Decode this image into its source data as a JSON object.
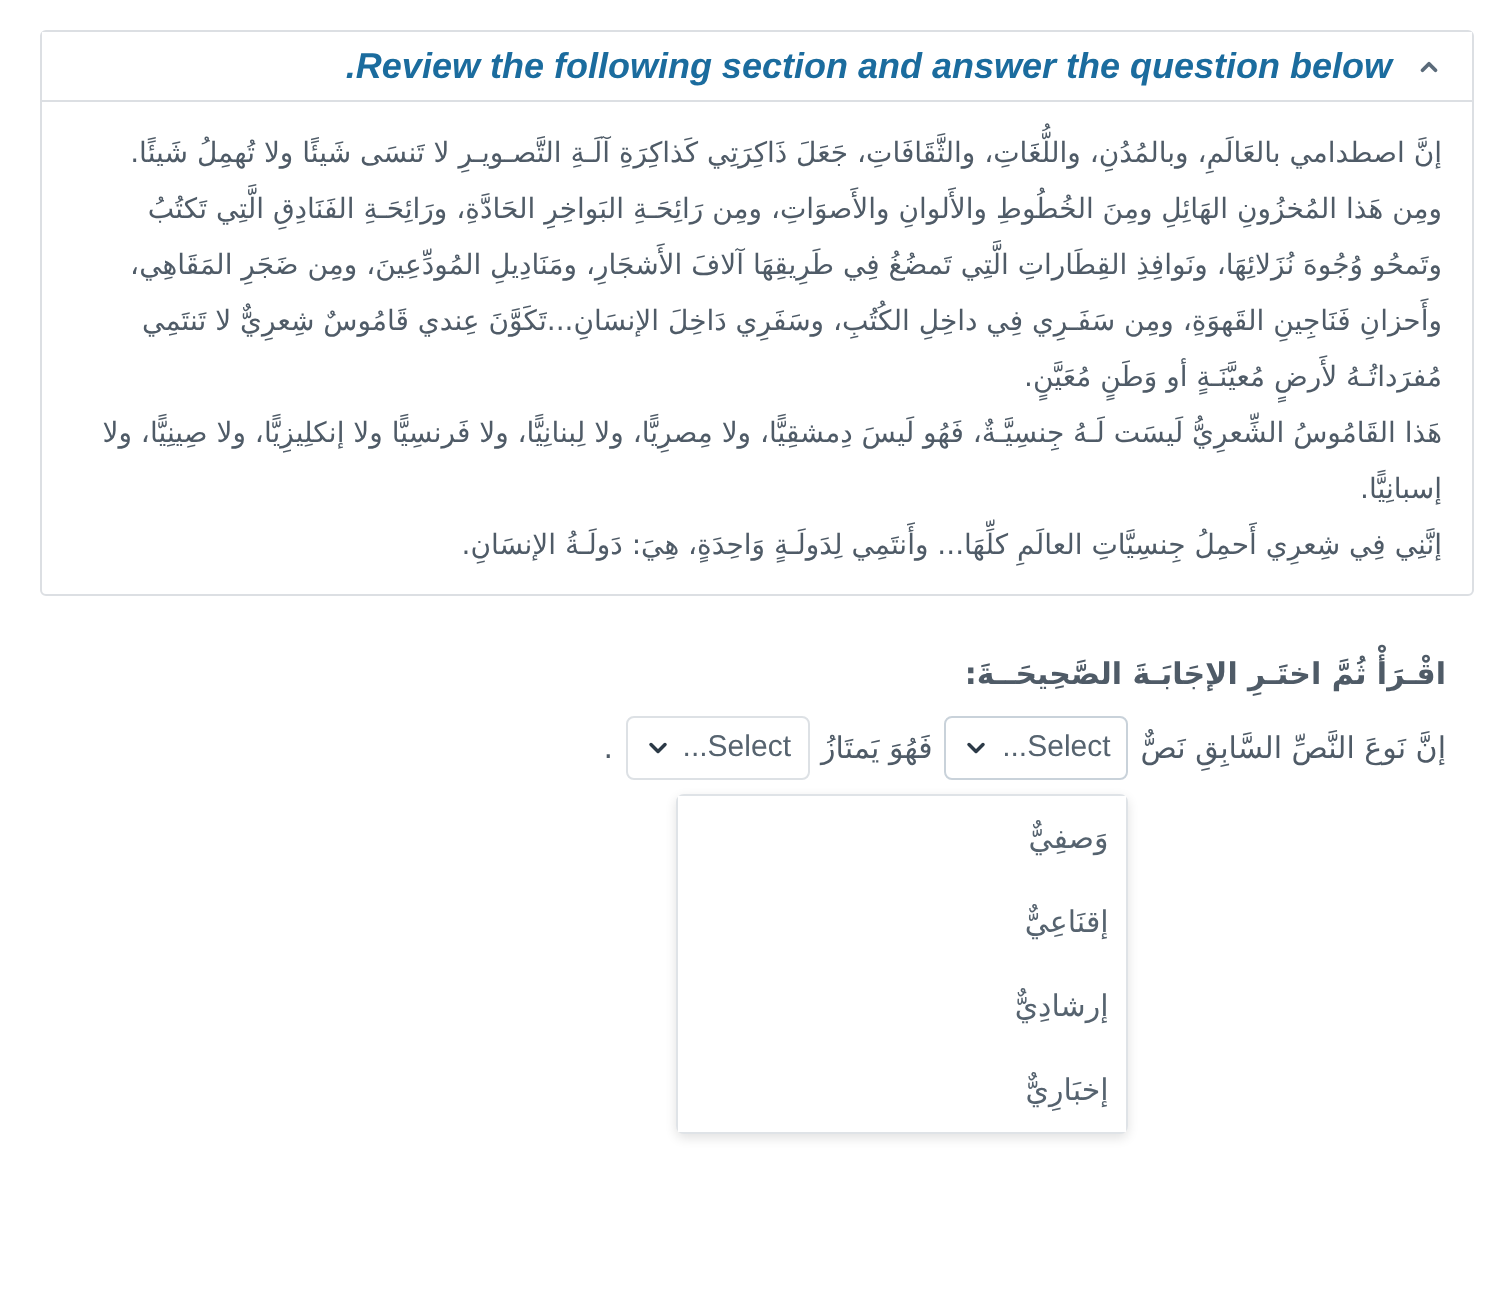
{
  "header": {
    "title": "Review the following section and answer the question below.",
    "expanded": true
  },
  "passage": {
    "paragraphs": [
      "إنَّ اصطدامي بالعَالَمِ، وبالمُدُنِ، واللُّغَاتِ، والثَّقَافَاتِ، جَعَلَ ذَاكِرَتِي كَذاكِرَةِ آلَـةِ التَّصـويـرِ لا تَنسَى شَيئًا ولا تُهمِلُ شَيئًا.",
      "ومِن هَذا المُخزُونِ الهَائِلِ ومِنَ الخُطُوطِ والأَلوانِ والأَصوَاتِ، ومِن رَائِحَـةِ البَواخِرِ الحَادَّةِ، ورَائِحَـةِ الفَنَادِقِ الَّتِي تَكتُبُ وتَمحُو وُجُوهَ نُزَلائِهَا، ونَوافِذِ القِطَاراتِ الَّتِي تَمضُغُ فِي طَرِيقِهَا آلافَ الأَشجَارِ، ومَنَادِيلِ المُودِّعِينَ، ومِن ضَجَرِ المَقَاهِي، وأَحزانِ فَنَاجِينِ القَهوَةِ، ومِن سَفَـرِي فِي داخِلِ الكُتُبِ، وسَفَرِي دَاخِلَ الإنسَانِ...تَكَوَّنَ عِندي قَامُوسٌ شِعرِيٌّ لا تَنتَمِي مُفرَداتُـهُ لأَرضٍ مُعيَّنَـةٍ أو وَطَنٍ مُعَيَّنٍ.",
      "هَذا القَامُوسُ الشِّعرِيُّ لَيسَت لَـهُ جِنسِيَّـةٌ، فَهُو لَيسَ دِمشقِيًّا، ولا مِصرِيًّا، ولا لِبنانِيًّا، ولا فَرنسِيًّا ولا إنكلِيزِيًّا، ولا صِينِيًّا، ولا إسبانِيًّا.",
      "إنَّنِي فِي شِعرِي أَحمِلُ جِنسِيَّاتِ العالَمِ كلِّهَا... وأَنتَمِي لِدَولَـةٍ وَاحِدَةٍ، هِيَ: دَولَـةُ الإنسَانِ."
    ]
  },
  "question": {
    "instruction": "اقْـرَأْ ثُمَّ اختَـرِ الإجَابَـةَ الصَّحِيحَــةَ:",
    "parts": [
      {
        "kind": "text",
        "text": "إنَّ نَوعَ النَّصِّ السَّابِقِ نَصٌّ"
      },
      {
        "kind": "select",
        "placeholder": "Select...",
        "expanded": true,
        "options": [
          {
            "label": "وَصفِيٌّ",
            "selected": false
          },
          {
            "label": "إقنَاعِيٌّ",
            "selected": false
          },
          {
            "label": "إرشادِيٌّ",
            "selected": false
          },
          {
            "label": "إخبَارِيٌّ",
            "selected": false
          }
        ]
      },
      {
        "kind": "text",
        "text": "فَهُوَ يَمتَازُ"
      },
      {
        "kind": "select",
        "placeholder": "Select...",
        "expanded": false
      },
      {
        "kind": "text",
        "text": "."
      }
    ]
  }
}
